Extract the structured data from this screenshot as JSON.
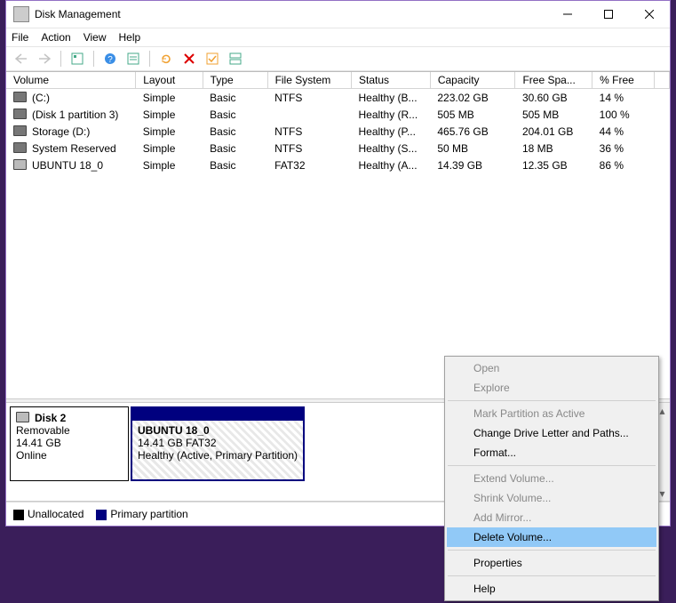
{
  "window": {
    "title": "Disk Management"
  },
  "menu": {
    "file": "File",
    "action": "Action",
    "view": "View",
    "help": "Help"
  },
  "columns": [
    "Volume",
    "Layout",
    "Type",
    "File System",
    "Status",
    "Capacity",
    "Free Spa...",
    "% Free"
  ],
  "volumes": [
    {
      "name": "(C:)",
      "layout": "Simple",
      "type": "Basic",
      "fs": "NTFS",
      "status": "Healthy (B...",
      "cap": "223.02 GB",
      "free": "30.60 GB",
      "pct": "14 %"
    },
    {
      "name": "(Disk 1 partition 3)",
      "layout": "Simple",
      "type": "Basic",
      "fs": "",
      "status": "Healthy (R...",
      "cap": "505 MB",
      "free": "505 MB",
      "pct": "100 %"
    },
    {
      "name": "Storage (D:)",
      "layout": "Simple",
      "type": "Basic",
      "fs": "NTFS",
      "status": "Healthy (P...",
      "cap": "465.76 GB",
      "free": "204.01 GB",
      "pct": "44 %"
    },
    {
      "name": "System Reserved",
      "layout": "Simple",
      "type": "Basic",
      "fs": "NTFS",
      "status": "Healthy (S...",
      "cap": "50 MB",
      "free": "18 MB",
      "pct": "36 %"
    },
    {
      "name": "UBUNTU 18_0",
      "layout": "Simple",
      "type": "Basic",
      "fs": "FAT32",
      "status": "Healthy (A...",
      "cap": "14.39 GB",
      "free": "12.35 GB",
      "pct": "86 %",
      "usb": true
    }
  ],
  "disk": {
    "label": "Disk 2",
    "kind": "Removable",
    "size": "14.41 GB",
    "state": "Online",
    "part": {
      "name": "UBUNTU 18_0",
      "line2": "14.41 GB FAT32",
      "line3": "Healthy (Active, Primary Partition)"
    }
  },
  "legend": {
    "unalloc": "Unallocated",
    "primary": "Primary partition"
  },
  "ctx": {
    "open": "Open",
    "explore": "Explore",
    "markactive": "Mark Partition as Active",
    "changeletter": "Change Drive Letter and Paths...",
    "format": "Format...",
    "extend": "Extend Volume...",
    "shrink": "Shrink Volume...",
    "mirror": "Add Mirror...",
    "delete": "Delete Volume...",
    "properties": "Properties",
    "help": "Help"
  }
}
